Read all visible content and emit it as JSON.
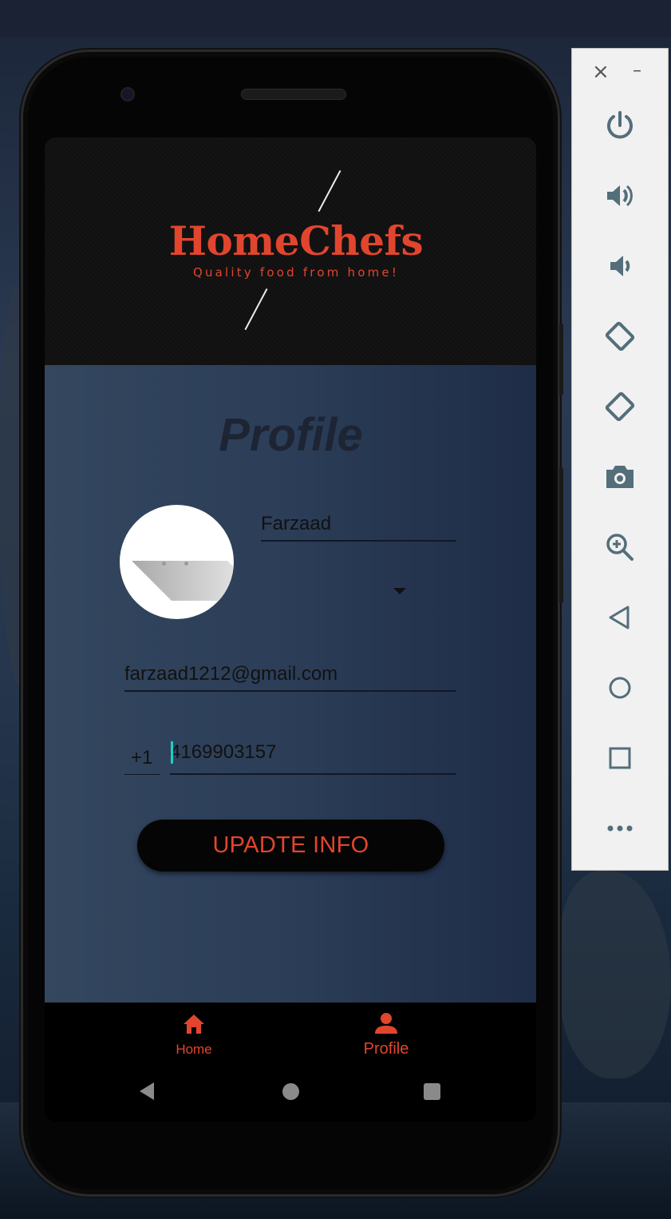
{
  "app": {
    "brand_title": "HomeChefs",
    "brand_tagline": "Quality food from home!",
    "page_title": "Profile",
    "accent_color": "#e2452e"
  },
  "form": {
    "name_value": "Farzaad",
    "role_selected": "",
    "email_value": "farzaad1212@gmail.com",
    "country_code": "+1",
    "phone_value": "4169903157",
    "update_button_label": "UPADTE INFO"
  },
  "bottom_nav": {
    "items": [
      {
        "label": "Home",
        "icon": "home-icon"
      },
      {
        "label": "Profile",
        "icon": "person-icon"
      }
    ]
  },
  "emulator_toolbar": {
    "buttons": [
      "power-icon",
      "volume-up-icon",
      "volume-down-icon",
      "rotate-left-icon",
      "rotate-right-icon",
      "camera-icon",
      "zoom-icon",
      "back-icon",
      "home-circle-icon",
      "overview-icon",
      "more-icon"
    ]
  }
}
